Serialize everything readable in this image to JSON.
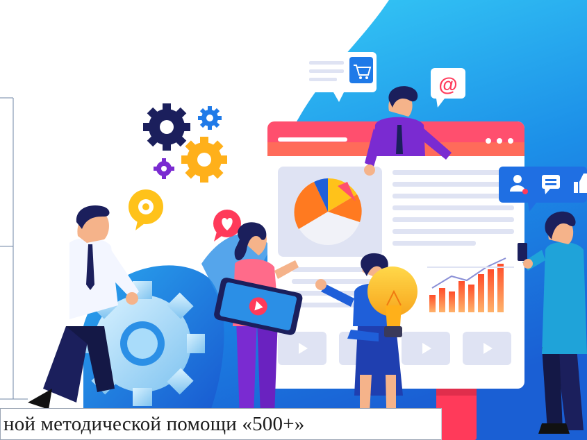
{
  "caption": {
    "text": "ной методической помощи «500+»"
  },
  "speech_bubbles": {
    "email_symbol": "@"
  },
  "icons": [
    "gear-icon",
    "cart-icon",
    "email-icon",
    "heart-icon",
    "play-icon",
    "user-icon",
    "chat-icon",
    "like-icon",
    "lightbulb-icon",
    "pie-chart-icon",
    "bar-chart-icon",
    "shopping-bag-icon"
  ],
  "colors": {
    "blob_light": "#35c6f4",
    "blob_dark": "#1565d8",
    "browser_header": "#ff5c6c",
    "browser_body": "#ffffff",
    "panel": "#dfe3f3",
    "accent_orange": "#ff7a20",
    "accent_yellow": "#ffc21a",
    "accent_purple": "#7a2bd1",
    "navy": "#1b1f5c"
  }
}
